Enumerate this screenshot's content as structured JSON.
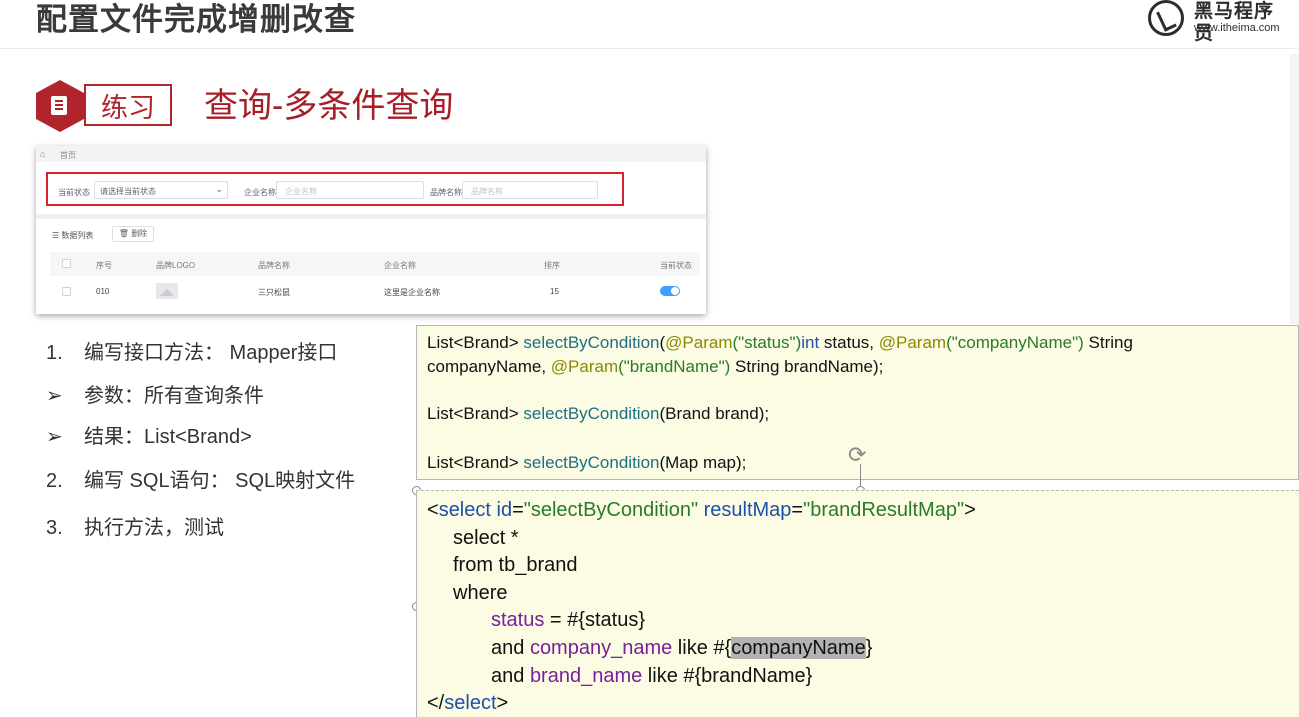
{
  "header": {
    "title": "配置文件完成增删改查",
    "logo_name": "黑马程序员",
    "logo_url": "www.itheima.com"
  },
  "section": {
    "tag": "练习",
    "title": "查询-多条件查询"
  },
  "mock_ui": {
    "breadcrumb": "首页",
    "filter": {
      "status_label": "当前状态",
      "status_value": "请选择当前状态",
      "company_label": "企业名称",
      "company_placeholder": "企业名称",
      "brand_label": "品牌名称",
      "brand_placeholder": "品牌名称"
    },
    "list_title": "数据列表",
    "delete_button": "删除",
    "columns": [
      "序号",
      "品牌LOGO",
      "品牌名称",
      "企业名称",
      "排序",
      "当前状态"
    ],
    "row": {
      "id": "010",
      "brand_name": "三只松鼠",
      "company_name": "这里是企业名称",
      "order": "15",
      "status_on": true
    },
    "accent_color": "#409eff",
    "highlight_color": "#d2252c"
  },
  "steps": [
    {
      "num": "1.",
      "label": "编写接口方法： Mapper接口"
    },
    {
      "num": "➢",
      "label": "参数：所有查询条件"
    },
    {
      "num": "➢",
      "label": "结果：List<Brand>"
    },
    {
      "num": "2.",
      "label": "编写 SQL语句： SQL映射文件"
    },
    {
      "num": "3.",
      "label": "执行方法，测试"
    }
  ],
  "code_interface": {
    "l1_type": "List<Brand> ",
    "l1_method": "selectByCondition",
    "l1_open": "(",
    "l1_ann1": "@Param",
    "l1_str1": "(\"status\")",
    "l1_int": "int",
    "l1_rest1": " status, ",
    "l1_ann2": "@Param",
    "l1_str2": "(\"companyName\")",
    "l1_rest2": " String",
    "l2_a": "companyName, ",
    "l2_ann": "@Param",
    "l2_str": "(\"brandName\")",
    "l2_rest": " String brandName);",
    "l3_type": "List<Brand> ",
    "l3_method": "selectByCondition",
    "l3_rest": "(Brand brand);",
    "l4_type": "List<Brand> ",
    "l4_method": "selectByCondition",
    "l4_rest": "(Map map);"
  },
  "code_sql": {
    "open_lt": "<",
    "tag": "select",
    "attr_id": " id",
    "eq1": "=",
    "id_val": "\"selectByCondition\"",
    "attr_rm": " resultMap",
    "eq2": "=",
    "rm_val": "\"brandResultMap\"",
    "open_gt": ">",
    "line_select": "select *",
    "line_from": "from tb_brand",
    "line_where": "where",
    "status_col": "status",
    "status_rest": " = #{status}",
    "and1": "and ",
    "company_col": "company_name",
    "company_like": " like #{",
    "company_param": "companyName",
    "company_close": "}",
    "and2": "and ",
    "brand_col": "brand_name",
    "brand_rest": " like #{brandName}",
    "close_lt": "</",
    "close_tag": "select",
    "close_gt": ">"
  },
  "icons": [
    "home-icon",
    "list-icon",
    "trash-icon",
    "chevron-down-icon",
    "image-placeholder-icon",
    "document-icon",
    "rotate-handle-icon"
  ]
}
